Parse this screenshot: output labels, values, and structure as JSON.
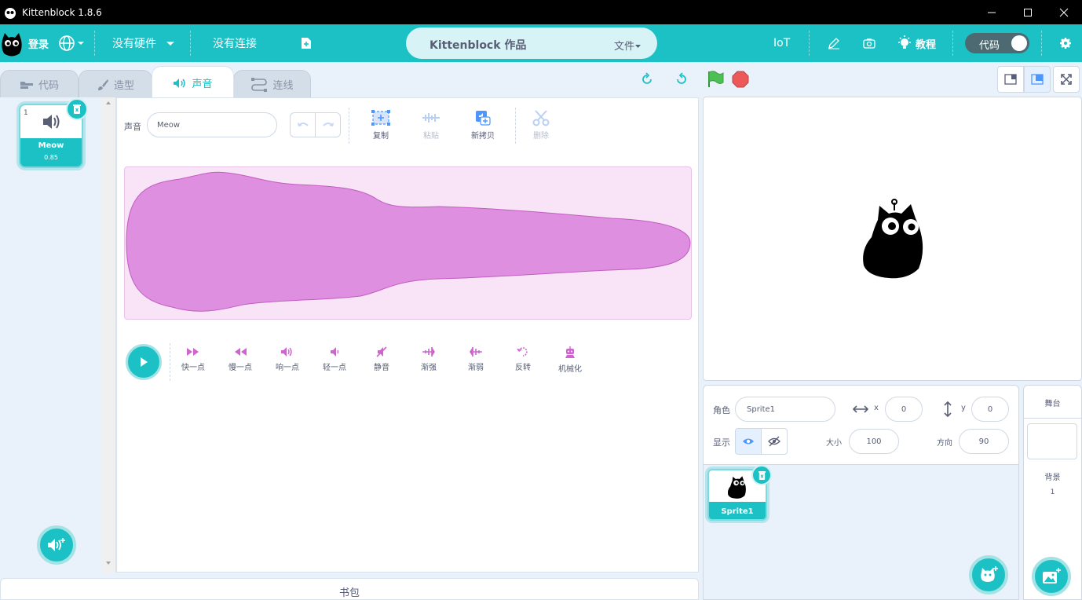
{
  "window": {
    "title": "Kittenblock 1.8.6"
  },
  "menubar": {
    "login": "登录",
    "hardware": "没有硬件",
    "connection": "没有连接",
    "project_title": "Kittenblock 作品",
    "file_menu": "文件",
    "iot": "IoT",
    "tutorial": "教程",
    "code_toggle": "代码"
  },
  "tabs": [
    {
      "label": "代码",
      "icon": "code-icon",
      "active": false
    },
    {
      "label": "造型",
      "icon": "brush-icon",
      "active": false
    },
    {
      "label": "声音",
      "icon": "speaker-icon",
      "active": true
    },
    {
      "label": "连线",
      "icon": "wire-icon",
      "active": false
    }
  ],
  "sound_list": [
    {
      "index": "1",
      "name": "Meow",
      "duration": "0.85"
    }
  ],
  "editor": {
    "sound_label": "声音",
    "sound_name": "Meow",
    "tools": [
      {
        "label": "复制",
        "icon": "copy-icon",
        "enabled": true
      },
      {
        "label": "粘贴",
        "icon": "paste-icon",
        "enabled": false
      },
      {
        "label": "新拷贝",
        "icon": "new-copy-icon",
        "enabled": true
      },
      {
        "label": "删除",
        "icon": "scissors-icon",
        "enabled": false
      }
    ],
    "effects": [
      {
        "label": "快一点",
        "icon": "fast-icon"
      },
      {
        "label": "慢一点",
        "icon": "slow-icon"
      },
      {
        "label": "响一点",
        "icon": "louder-icon"
      },
      {
        "label": "轻一点",
        "icon": "softer-icon"
      },
      {
        "label": "静音",
        "icon": "mute-icon"
      },
      {
        "label": "渐强",
        "icon": "fade-in-icon"
      },
      {
        "label": "渐弱",
        "icon": "fade-out-icon"
      },
      {
        "label": "反转",
        "icon": "reverse-icon"
      },
      {
        "label": "机械化",
        "icon": "robot-icon"
      }
    ],
    "colors": {
      "wave_fill": "#de8fdf",
      "wave_bg": "#f9e4f7",
      "accent": "#1bc1c4",
      "effect": "#cf63cf"
    }
  },
  "backpack": {
    "label": "书包"
  },
  "sprite_info": {
    "sprite_label": "角色",
    "sprite_name": "Sprite1",
    "x_label": "x",
    "x_value": "0",
    "y_label": "y",
    "y_value": "0",
    "show_label": "显示",
    "size_label": "大小",
    "size_value": "100",
    "direction_label": "方向",
    "direction_value": "90"
  },
  "sprites": [
    {
      "name": "Sprite1"
    }
  ],
  "stage_col": {
    "title": "舞台",
    "backdrop_label": "背景",
    "backdrop_count": "1"
  }
}
